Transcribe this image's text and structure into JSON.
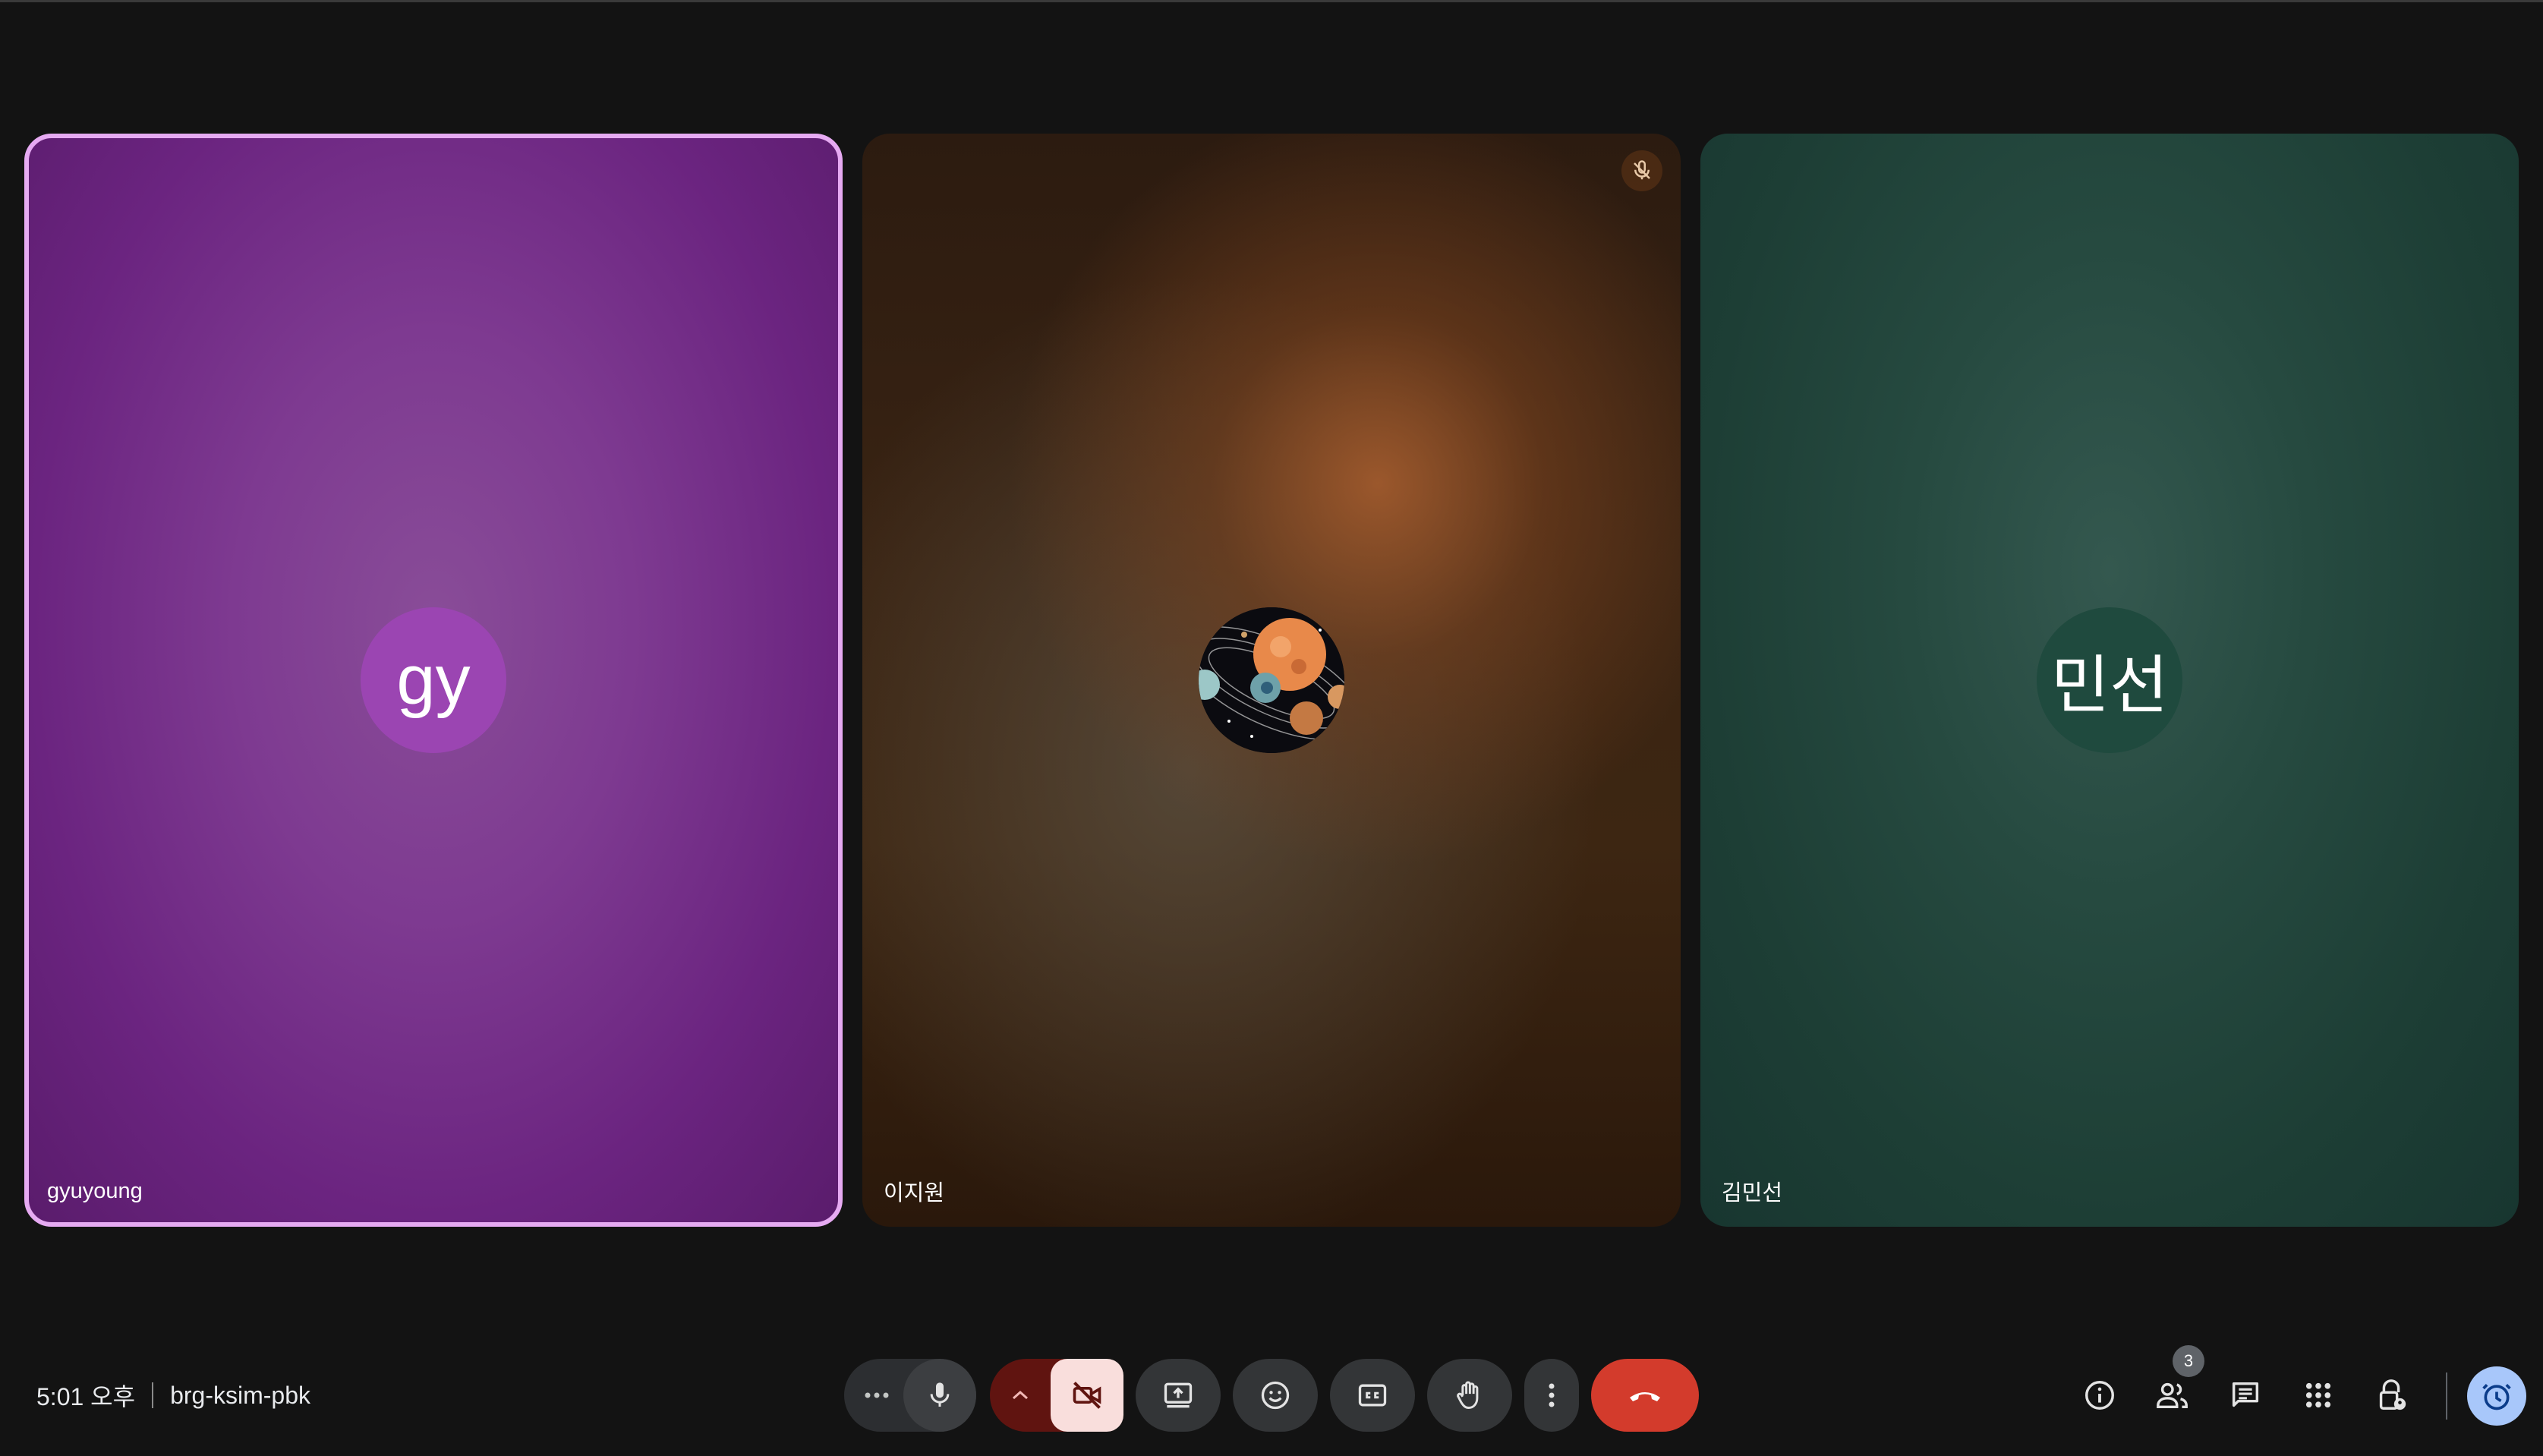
{
  "participants": [
    {
      "name": "gyuyoung",
      "initials": "gy",
      "active_speaker": true,
      "avatar_color": "#9b45b2"
    },
    {
      "name": "이지원",
      "avatar": "planets-image",
      "muted": true
    },
    {
      "name": "김민선",
      "initials": "민선",
      "avatar_color": "#1f4a3e"
    }
  ],
  "meeting": {
    "time": "5:01 오후",
    "code": "brg-ksim-pbk"
  },
  "controls": {
    "more_audio": "more-options-icon",
    "mic": "mic-icon",
    "camera_options": "chevron-up-icon",
    "camera_off": "videocam-off-icon",
    "present": "present-screen-icon",
    "reactions": "emoji-icon",
    "captions": "closed-caption-icon",
    "raise_hand": "hand-icon",
    "more": "more-vert-icon",
    "leave": "call-end-icon"
  },
  "side_panel": {
    "people_count": "3",
    "icons": [
      "info-icon",
      "people-icon",
      "chat-icon",
      "apps-icon",
      "host-controls-icon",
      "timer-icon"
    ]
  },
  "colors": {
    "active_border": "#e6aaf2",
    "leave": "#d33b2c",
    "camera_off_bg": "#601410",
    "camera_off_fg": "#f9dedc",
    "timer": "#a8c7fa"
  }
}
